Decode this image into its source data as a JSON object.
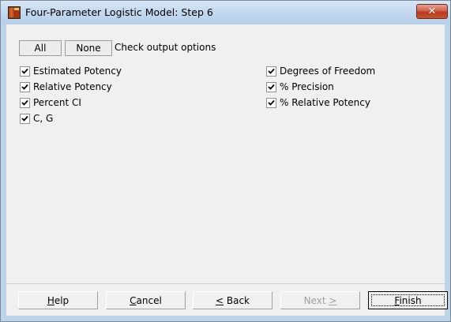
{
  "window": {
    "title": "Four-Parameter Logistic Model: Step 6",
    "close_label": "✕"
  },
  "top_buttons": {
    "all_label": "All",
    "none_label": "None",
    "hint": "Check output options"
  },
  "options_left": [
    {
      "label": "Estimated Potency",
      "checked": true
    },
    {
      "label": "Relative Potency",
      "checked": true
    },
    {
      "label": "Percent CI",
      "checked": true
    },
    {
      "label": "C, G",
      "checked": true
    }
  ],
  "options_right": [
    {
      "label": "Degrees of Freedom",
      "checked": true
    },
    {
      "label": "% Precision",
      "checked": true
    },
    {
      "label": "% Relative Potency",
      "checked": true
    }
  ],
  "footer": {
    "help_pre": "",
    "help_key": "H",
    "help_post": "elp",
    "cancel_pre": "",
    "cancel_key": "C",
    "cancel_post": "ancel",
    "back_pre": "",
    "back_key": "<",
    "back_post": " Back",
    "next_pre": "Next ",
    "next_key": ">",
    "next_post": "",
    "finish_pre": "",
    "finish_key": "F",
    "finish_post": "inish",
    "next_enabled": false
  },
  "colors": {
    "titlebar": "#c3d8ee",
    "client_bg": "#f0f0f0",
    "close_red": "#c8522e"
  }
}
